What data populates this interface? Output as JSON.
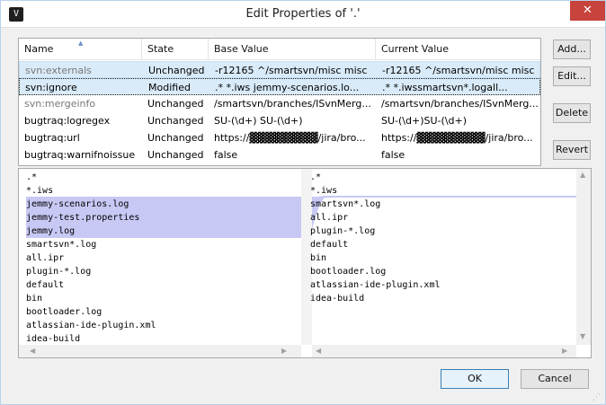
{
  "window": {
    "title": "Edit Properties of '.'",
    "close_glyph": "✕",
    "app_icon_glyph": "V"
  },
  "table": {
    "columns": {
      "name": "Name",
      "state": "State",
      "base": "Base Value",
      "current": "Current Value"
    },
    "rows": [
      {
        "name": "svn:externals",
        "state": "Unchanged",
        "base": "-r12165 ^/smartsvn/misc misc",
        "current": "-r12165 ^/smartsvn/misc misc"
      },
      {
        "name": "svn:ignore",
        "state": "Modified",
        "base": ".* *.iws jemmy-scenarios.lo...",
        "current": ".* *.iwssmartsvn*.logall..."
      },
      {
        "name": "svn:mergeinfo",
        "state": "Unchanged",
        "base": "/smartsvn/branches/ISvnMerg...",
        "current": "/smartsvn/branches/ISvnMerg..."
      },
      {
        "name": "bugtraq:logregex",
        "state": "Unchanged",
        "base": "SU-(\\d+) SU-(\\d+)",
        "current": "SU-(\\d+)SU-(\\d+)"
      },
      {
        "name": "bugtraq:url",
        "state": "Unchanged",
        "base": "https://▓▓▓▓▓▓▓▓▓/jira/bro...",
        "current": "https://▓▓▓▓▓▓▓▓▓/jira/bro..."
      },
      {
        "name": "bugtraq:warnifnoissue",
        "state": "Unchanged",
        "base": "false",
        "current": "false"
      }
    ]
  },
  "side_buttons": {
    "add": "Add...",
    "edit": "Edit...",
    "delete": "Delete",
    "revert": "Revert"
  },
  "diff": {
    "left": [
      ".*",
      "*.iws",
      "jemmy-scenarios.log",
      "jemmy-test.properties",
      "jemmy.log",
      "smartsvn*.log",
      "all.ipr",
      "plugin-*.log",
      "default",
      "bin",
      "bootloader.log",
      "atlassian-ide-plugin.xml",
      "idea-build"
    ],
    "right": [
      ".*",
      "*.iws",
      "smartsvn*.log",
      "all.ipr",
      "plugin-*.log",
      "default",
      "bin",
      "bootloader.log",
      "atlassian-ide-plugin.xml",
      "idea-build"
    ],
    "colors": {
      "removed_highlight": "#c8c8f5"
    }
  },
  "buttons": {
    "ok": "OK",
    "cancel": "Cancel"
  }
}
